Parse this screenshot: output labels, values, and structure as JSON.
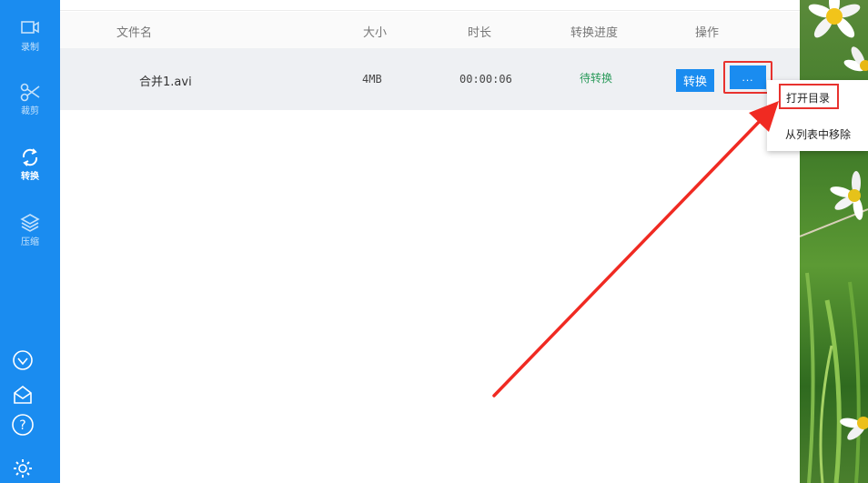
{
  "sidebar": {
    "items": [
      {
        "label": "录制",
        "icon": "record-icon"
      },
      {
        "label": "裁剪",
        "icon": "scissors-icon"
      },
      {
        "label": "转换",
        "icon": "convert-icon"
      },
      {
        "label": "压缩",
        "icon": "compress-icon"
      }
    ],
    "footer_icons": [
      "vip-icon",
      "mail-icon",
      "help-icon",
      "settings-icon"
    ]
  },
  "table": {
    "headers": [
      "文件名",
      "大小",
      "时长",
      "转换进度",
      "操作"
    ],
    "rows": [
      {
        "name": "合并1.avi",
        "size": "4MB",
        "duration": "00:00:06",
        "status": "待转换",
        "convert_label": "转换",
        "more_label": "..."
      }
    ]
  },
  "context_menu": {
    "items": [
      "打开目录",
      "从列表中移除"
    ]
  },
  "colors": {
    "accent": "#1a8cf0",
    "highlight": "#e8322e",
    "status": "#2a9a5a"
  }
}
